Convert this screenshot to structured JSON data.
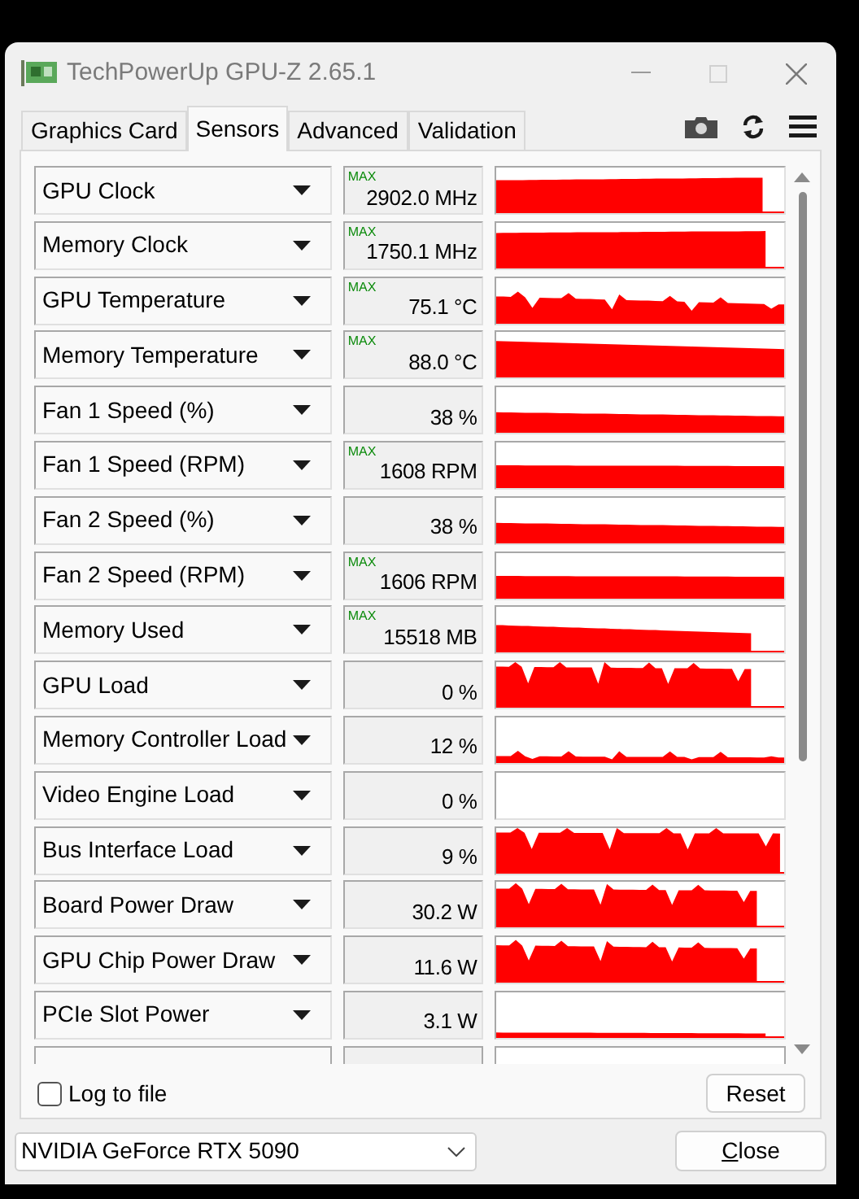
{
  "window": {
    "title": "TechPowerUp GPU-Z 2.65.1"
  },
  "tabs": [
    {
      "label": "Graphics Card",
      "selected": false
    },
    {
      "label": "Sensors",
      "selected": true
    },
    {
      "label": "Advanced",
      "selected": false
    },
    {
      "label": "Validation",
      "selected": false
    }
  ],
  "sensors": [
    {
      "name": "GPU Clock",
      "badge": "MAX",
      "value": "2902.0 MHz"
    },
    {
      "name": "Memory Clock",
      "badge": "MAX",
      "value": "1750.1 MHz"
    },
    {
      "name": "GPU Temperature",
      "badge": "MAX",
      "value": "75.1 °C"
    },
    {
      "name": "Memory Temperature",
      "badge": "MAX",
      "value": "88.0 °C"
    },
    {
      "name": "Fan 1 Speed (%)",
      "value": "38 %"
    },
    {
      "name": "Fan 1 Speed (RPM)",
      "badge": "MAX",
      "value": "1608 RPM"
    },
    {
      "name": "Fan 2 Speed (%)",
      "value": "38 %"
    },
    {
      "name": "Fan 2 Speed (RPM)",
      "badge": "MAX",
      "value": "1606 RPM"
    },
    {
      "name": "Memory Used",
      "badge": "MAX",
      "value": "15518 MB"
    },
    {
      "name": "GPU Load",
      "value": "0 %"
    },
    {
      "name": "Memory Controller Load",
      "value": "12 %"
    },
    {
      "name": "Video Engine Load",
      "value": "0 %"
    },
    {
      "name": "Bus Interface Load",
      "value": "9 %"
    },
    {
      "name": "Board Power Draw",
      "value": "30.2 W"
    },
    {
      "name": "GPU Chip Power Draw",
      "value": "11.6 W"
    },
    {
      "name": "PCIe Slot Power",
      "value": "3.1 W"
    }
  ],
  "log_to_file": {
    "label": "Log to file",
    "checked": false
  },
  "reset_button": "Reset",
  "device_select": {
    "value": "NVIDIA GeForce RTX 5090"
  },
  "close_button": "Close"
}
